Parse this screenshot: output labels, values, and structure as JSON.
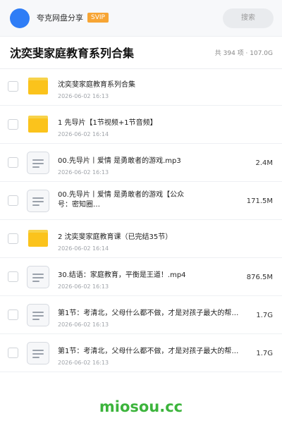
{
  "header": {
    "username": "夸克网盘分享",
    "badge": "SVIP",
    "search_placeholder": "搜索"
  },
  "title_bar": {
    "title": "沈奕斐家庭教育系列合集",
    "meta": "共 394 项 · 107.0G"
  },
  "files": [
    {
      "type": "folder",
      "icon": "folder-icon",
      "name": "沈奕斐家庭教育系列合集",
      "date": "2026-06-02 16:13",
      "size": ""
    },
    {
      "type": "folder",
      "icon": "folder-icon",
      "name": "1 先导片【1节视频+1节音频】",
      "date": "2026-06-02 16:14",
      "size": ""
    },
    {
      "type": "file",
      "icon": "file-doc-icon",
      "name": "00.先导片丨爱情 是勇敢者的游戏.mp3",
      "date": "2026-06-02 16:13",
      "size": "2.4M"
    },
    {
      "type": "file",
      "icon": "file-doc-icon",
      "name": "00.先导片丨爱情 是勇敢者的游戏【公众号：密知圈…",
      "date": "",
      "size": "171.5M"
    },
    {
      "type": "folder",
      "icon": "folder-icon",
      "name": "2 沈奕斐家庭教育课（已完结35节）",
      "date": "2026-06-02 16:14",
      "size": ""
    },
    {
      "type": "file",
      "icon": "file-doc-icon",
      "name": "30.结语：家庭教育，平衡是王道！.mp4",
      "date": "2026-06-02 16:13",
      "size": "876.5M"
    },
    {
      "type": "file",
      "icon": "file-doc-icon",
      "name": "第1节：考清北，父母什么都不做，才是对孩子最大的帮…",
      "date": "2026-06-02 16:13",
      "size": "1.7G"
    },
    {
      "type": "file",
      "icon": "file-doc-icon",
      "name": "第1节：考清北，父母什么都不做，才是对孩子最大的帮…",
      "date": "2026-06-02 16:13",
      "size": "1.7G"
    }
  ],
  "watermark": "miosou.cc",
  "colors": {
    "accent": "#2f7df6",
    "svip": "#f7a534",
    "folder": "#fbc31c",
    "watermark": "#3cb43c"
  }
}
